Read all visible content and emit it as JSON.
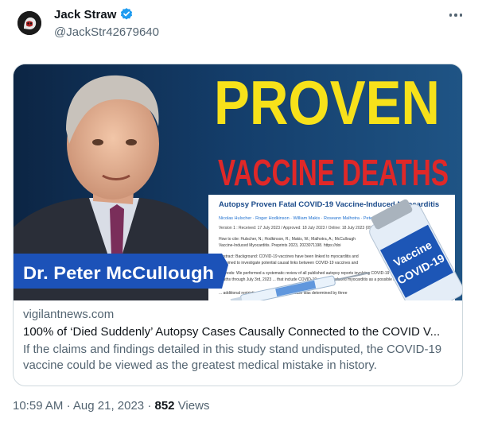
{
  "author": {
    "display_name": "Jack Straw",
    "handle": "@JackStr42679640",
    "verified": true,
    "avatar_icon": "gorilla-avatar-icon"
  },
  "more_icon": "more-horizontal-icon",
  "card": {
    "image": {
      "headline_1": "PROVEN",
      "headline_2": "VACCINE DEATHS",
      "paper_title": "Autopsy Proven Fatal COVID-19 Vaccine-Induced Myocarditis",
      "paper_authors": "Nicolas Hulscher · Roger Hodkinson · William Makis · Roseann Malhotra · Peter McC",
      "paper_line_1": "Version 1 : Received: 17 July 2023 / Approved: 18 July 2023 / Online: 18 July 2023 (09:34:51 CE",
      "paper_line_2": "How to cite: Hulscher, N.; Hodkinson, R.; Makis, W.; Malhotra, A.; McCullough",
      "paper_line_3": "Vaccine-Induced Myocarditis. Preprints 2023, 2023071198. https://doi",
      "paper_line_4": "Abstract: Background: COVID-19 vaccines have been linked to myocarditis and",
      "paper_line_5": "we aimed to investigate potential causal links between COVID-19 vaccines and",
      "paper_line_6": "Methods: We performed a systematic review of all published autopsy reports involving COVID-19 vaccination-related",
      "paper_line_7": "deaths through July 3rd, 2023 ... that include COVID-19 vaccine-induced myocarditis as a possible cause",
      "paper_line_8": "... additional restrictions. Causality in each case was determined by three",
      "vial_text_1": "Vaccine",
      "vial_text_2": "COVID-19",
      "name_banner": "Dr. Peter McCullough",
      "accent_yellow": "#f7e11a",
      "accent_red": "#e02828",
      "banner_blue": "#1c52b8"
    },
    "domain": "vigilantnews.com",
    "title": "100% of ‘Died Suddenly’ Autopsy Cases Causally Connected to the COVID V...",
    "description": "If the claims and findings detailed in this study stand undisputed, the COVID-19 vaccine could be viewed as the greatest medical mistake in history."
  },
  "meta": {
    "time": "10:59 AM",
    "separator": "·",
    "date": "Aug 21, 2023",
    "views_count": "852",
    "views_label": "Views"
  },
  "colors": {
    "text_primary": "#0f1419",
    "text_secondary": "#536471",
    "verified_blue": "#1d9bf0",
    "border": "#cfd9de"
  }
}
